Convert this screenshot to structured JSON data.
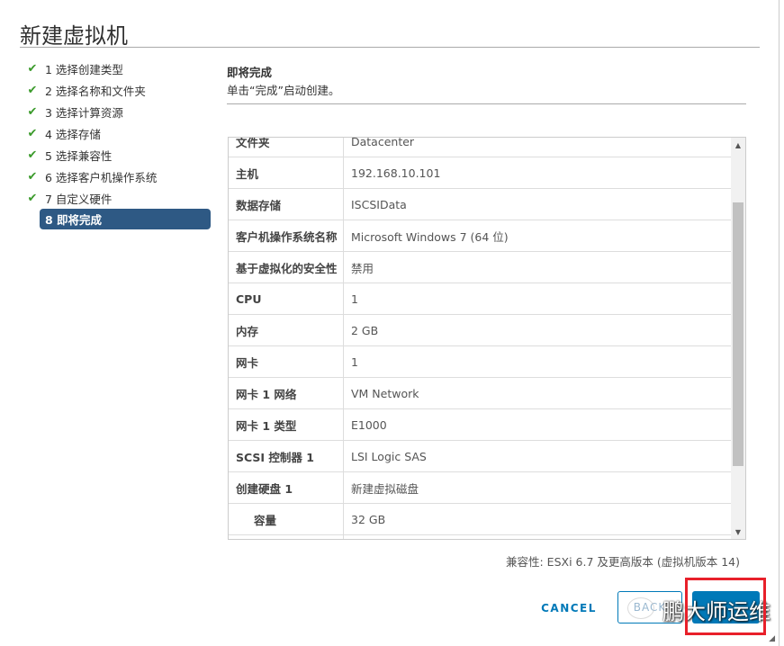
{
  "title": "新建虚拟机",
  "steps": [
    {
      "label": "1 选择创建类型",
      "done": true
    },
    {
      "label": "2 选择名称和文件夹",
      "done": true
    },
    {
      "label": "3 选择计算资源",
      "done": true
    },
    {
      "label": "4 选择存储",
      "done": true
    },
    {
      "label": "5 选择兼容性",
      "done": true
    },
    {
      "label": "6 选择客户机操作系统",
      "done": true
    },
    {
      "label": "7 自定义硬件",
      "done": true
    },
    {
      "label": "8 即将完成",
      "done": false,
      "active": true
    }
  ],
  "check_glyph": "✔",
  "header": {
    "title": "即将完成",
    "subtitle": "单击“完成”启动创建。"
  },
  "rows": [
    {
      "k": "文件夹",
      "v": "Datacenter"
    },
    {
      "k": "主机",
      "v": "192.168.10.101"
    },
    {
      "k": "数据存储",
      "v": "ISCSIData"
    },
    {
      "k": "客户机操作系统名称",
      "v": "Microsoft Windows 7 (64 位)"
    },
    {
      "k": "基于虚拟化的安全性",
      "v": "禁用"
    },
    {
      "k": "CPU",
      "v": "1"
    },
    {
      "k": "内存",
      "v": "2 GB"
    },
    {
      "k": "网卡",
      "v": "1"
    },
    {
      "k": "网卡 1 网络",
      "v": "VM Network"
    },
    {
      "k": "网卡 1 类型",
      "v": "E1000"
    },
    {
      "k": "SCSI 控制器 1",
      "v": "LSI Logic SAS"
    },
    {
      "k": "创建硬盘 1",
      "v": "新建虚拟磁盘"
    },
    {
      "k": "容量",
      "v": "32 GB",
      "indent": true
    }
  ],
  "compat": "兼容性: ESXi 6.7 及更高版本 (虚拟机版本 14)",
  "buttons": {
    "cancel": "CANCEL",
    "back": "BACK"
  },
  "watermark": "鹏大师运维",
  "colors": {
    "accent": "#0079b8",
    "active_step": "#2e5984",
    "check": "#3a9a2a",
    "annotation": "#e8202a"
  }
}
